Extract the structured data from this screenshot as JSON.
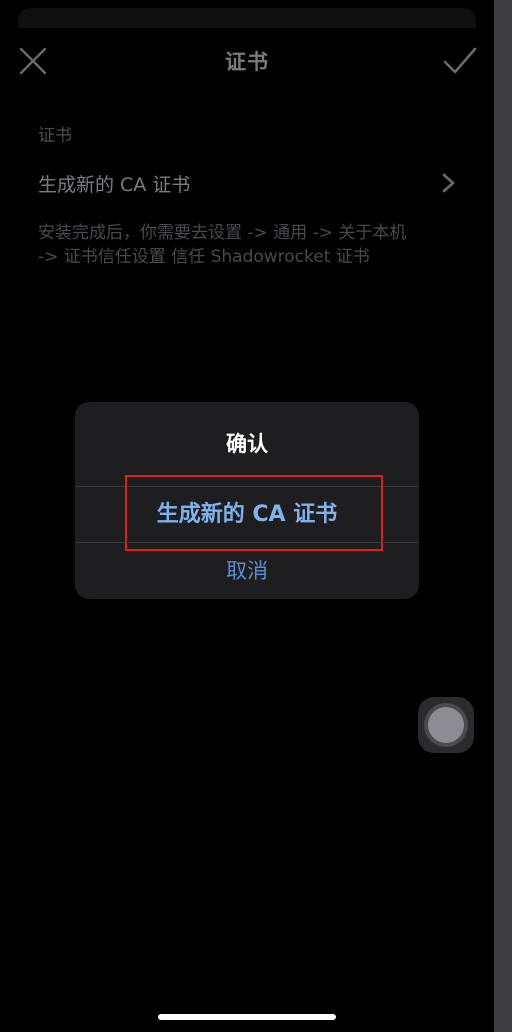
{
  "nav": {
    "title": "证书",
    "close_icon": "close-icon",
    "done_icon": "checkmark-icon"
  },
  "section": {
    "header": "证书",
    "row_label": "生成新的 CA 证书",
    "row_icon": "chevron-right-icon",
    "footer_line1": "安装完成后，你需要去设置 -> 通用 -> 关于本机",
    "footer_line2": "-> 证书信任设置 信任 Shadowrocket 证书"
  },
  "alert": {
    "title": "确认",
    "primary_action": "生成新的 CA 证书",
    "cancel_action": "取消"
  },
  "colors": {
    "accent": "#7fb3ec",
    "highlight": "#e02020",
    "alert_bg": "#1e1e20"
  }
}
